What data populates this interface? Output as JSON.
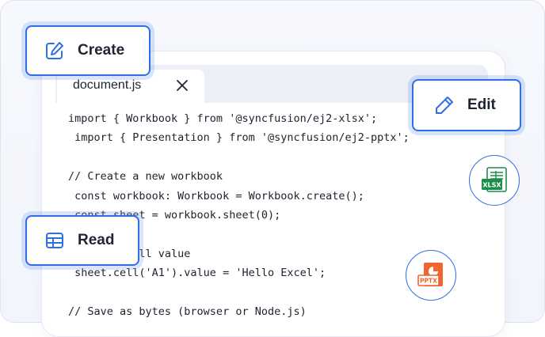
{
  "editor": {
    "tab_label": "document.js",
    "code": "import { Workbook } from '@syncfusion/ej2-xlsx';\n import { Presentation } from '@syncfusion/ej2-pptx';\n\n// Create a new workbook\n const workbook: Workbook = Workbook.create();\n const sheet = workbook.sheet(0);\n\n// Set a cell value\n sheet.cell('A1').value = 'Hello Excel';\n\n// Save as bytes (browser or Node.js)"
  },
  "actions": {
    "create_label": "Create",
    "edit_label": "Edit",
    "read_label": "Read"
  },
  "badges": {
    "xlsx_text": "XLSX",
    "pptx_text": "PPTX"
  },
  "colors": {
    "accent": "#2f6fe4",
    "excel_green": "#1d8f4b",
    "ppt_orange": "#f0642f"
  },
  "icons": {
    "create": "edit-square-icon",
    "edit": "pencil-icon",
    "read": "table-grid-icon",
    "close": "close-icon",
    "xlsx": "excel-file-icon",
    "pptx": "powerpoint-file-icon"
  }
}
